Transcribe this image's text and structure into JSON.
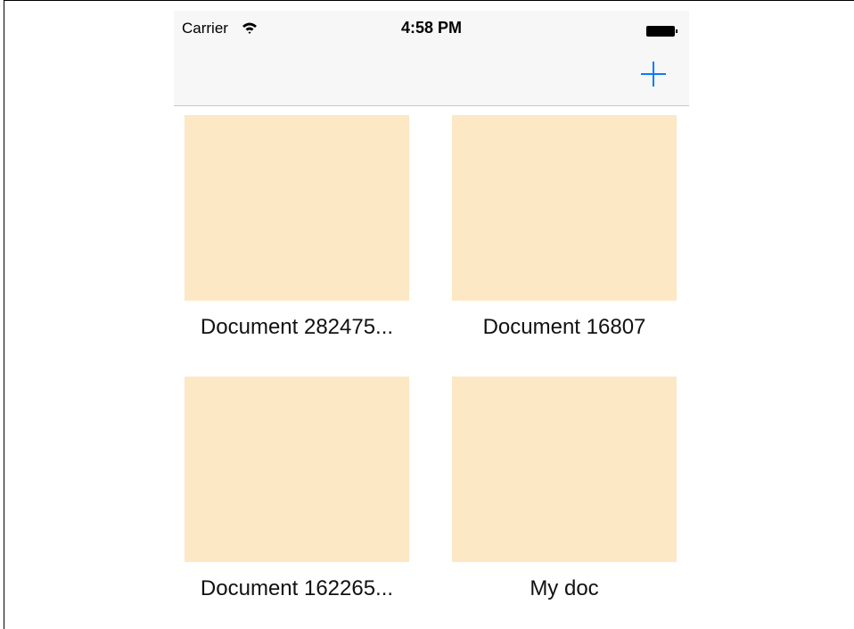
{
  "status_bar": {
    "carrier": "Carrier",
    "time": "4:58 PM"
  },
  "navbar": {
    "add_icon": "plus-icon",
    "accent_color": "#0a7aff"
  },
  "documents": [
    {
      "name": "Document 282475...",
      "thumb_color": "#fde8c5"
    },
    {
      "name": "Document 16807",
      "thumb_color": "#fde8c5"
    },
    {
      "name": "Document 162265...",
      "thumb_color": "#fde8c5"
    },
    {
      "name": "My doc",
      "thumb_color": "#fde8c5"
    }
  ]
}
